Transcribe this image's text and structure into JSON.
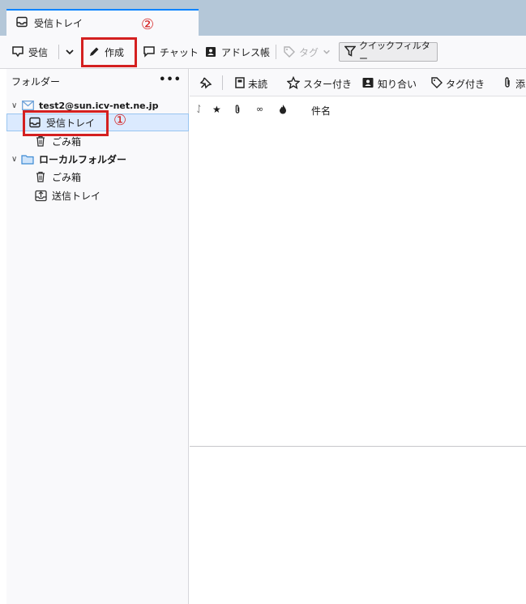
{
  "tab": {
    "label": "受信トレイ",
    "icon": "inbox-icon"
  },
  "toolbar": {
    "get_messages": "受信",
    "write": "作成",
    "chat": "チャット",
    "address_book": "アドレス帳",
    "tag": "タグ",
    "quick_filter": "クイックフィルター"
  },
  "folder_pane": {
    "header": "フォルダー",
    "menu": "•••",
    "account": "test2@sun.icv-net.ne.jp",
    "account_folders": [
      {
        "label": "受信トレイ",
        "icon": "inbox-icon",
        "selected": true
      },
      {
        "label": "ごみ箱",
        "icon": "trash-icon"
      }
    ],
    "local_folders": "ローカルフォルダー",
    "local_items": [
      {
        "label": "ごみ箱",
        "icon": "trash-icon"
      },
      {
        "label": "送信トレイ",
        "icon": "outbox-icon"
      }
    ]
  },
  "message_list": {
    "filters": {
      "unread": "未読",
      "starred": "スター付き",
      "contact": "知り合い",
      "tagged": "タグ付き",
      "attachment": "添"
    },
    "columns": {
      "subject": "件名"
    }
  },
  "annotations": {
    "one": "①",
    "two": "②"
  },
  "colors": {
    "accent": "#0a84ff",
    "annotation_red": "#d42020",
    "tabbar": "#b4c7d8"
  }
}
